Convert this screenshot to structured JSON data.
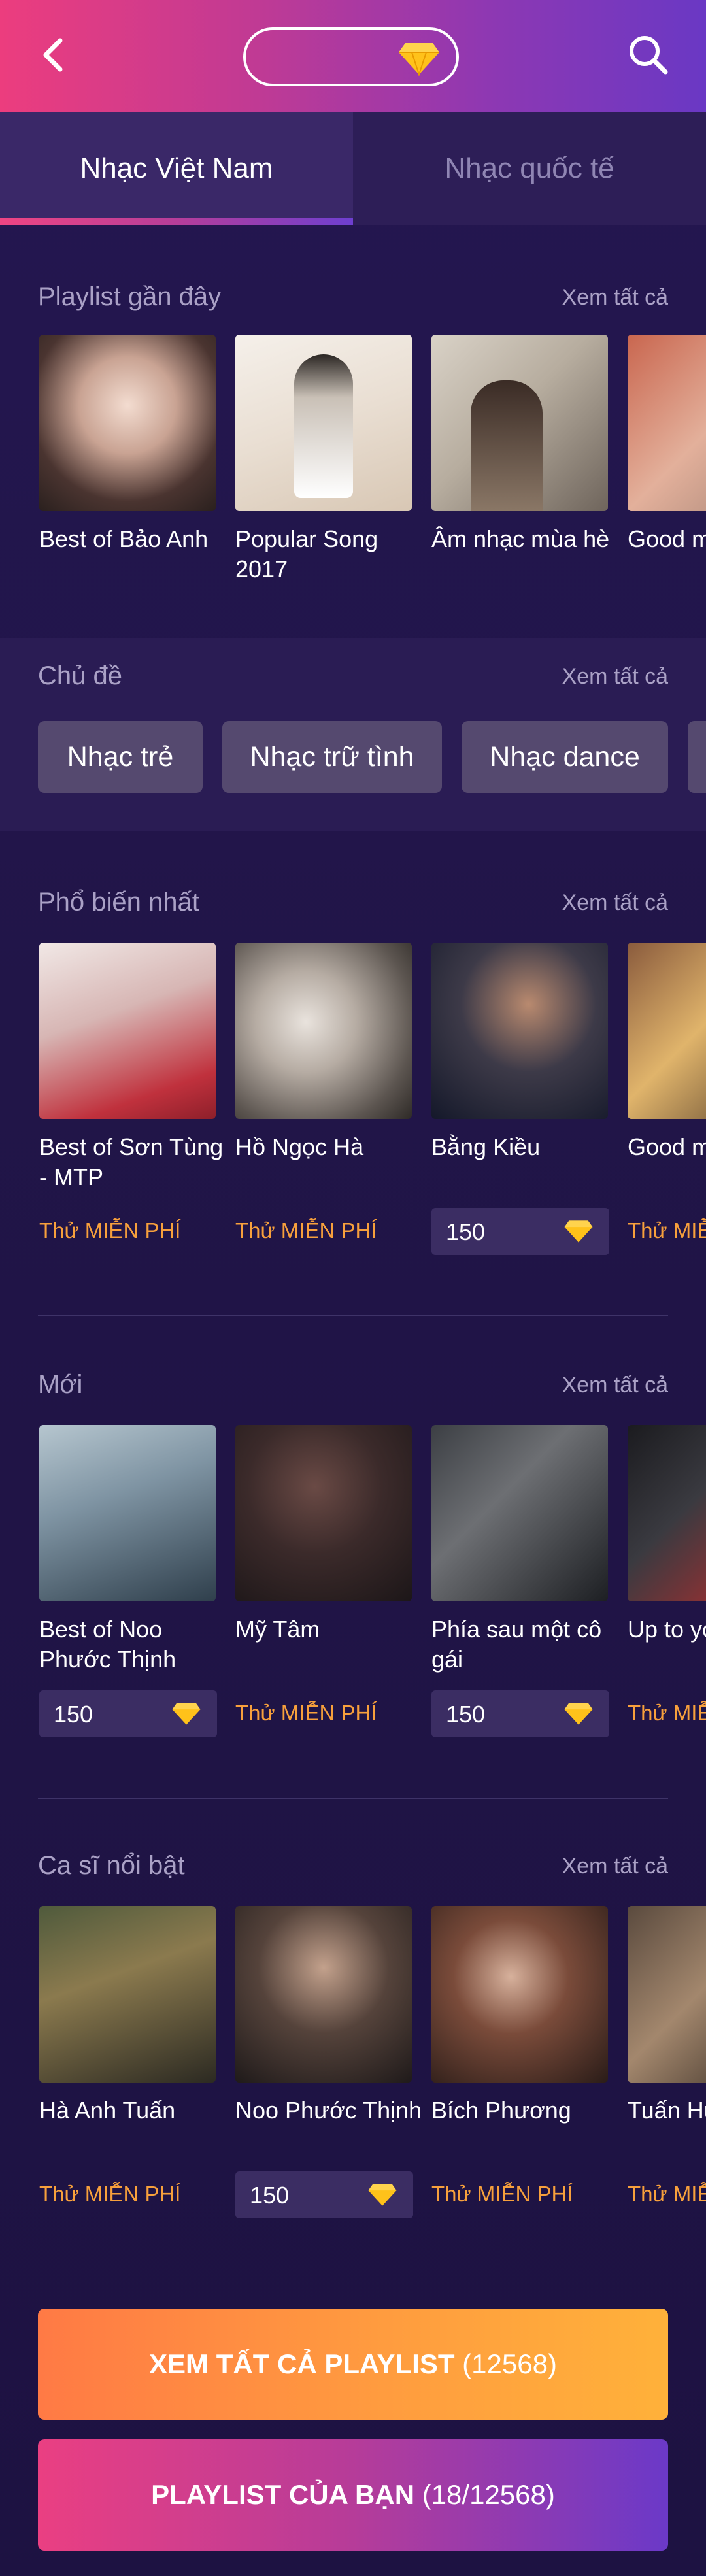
{
  "tabs": [
    {
      "label": "Nhạc Việt Nam",
      "active": true
    },
    {
      "label": "Nhạc quốc tế",
      "active": false
    }
  ],
  "see_all": "Xem tất cả",
  "sections": {
    "recent": {
      "title": "Playlist gần đây",
      "items": [
        {
          "caption": "Best of Bảo Anh"
        },
        {
          "caption": "Popular Song 2017"
        },
        {
          "caption": "Âm nhạc mùa hè"
        },
        {
          "caption": "Good m"
        }
      ]
    },
    "topics": {
      "title": "Chủ đề",
      "chips": [
        "Nhạc trẻ",
        "Nhạc trữ tình",
        "Nhạc dance"
      ]
    },
    "popular": {
      "title": "Phổ biến nhất",
      "items": [
        {
          "caption": "Best of Sơn Tùng - MTP",
          "price": "Thử MIỄN PHÍ"
        },
        {
          "caption": "Hồ Ngọc Hà",
          "price": "Thử MIỄN PHÍ"
        },
        {
          "caption": "Bằng Kiều",
          "price": "150"
        },
        {
          "caption": "Good m",
          "price": "Thử MIỄ"
        }
      ]
    },
    "new": {
      "title": "Mới",
      "items": [
        {
          "caption": "Best of Noo Phước Thịnh",
          "price": "150"
        },
        {
          "caption": "Mỹ Tâm",
          "price": "Thử MIỄN PHÍ"
        },
        {
          "caption": "Phía sau một cô gái",
          "price": "150"
        },
        {
          "caption": "Up to yo",
          "price": "Thử MIỄ"
        }
      ]
    },
    "artists": {
      "title": "Ca sĩ nổi bật",
      "items": [
        {
          "caption": "Hà Anh Tuấn",
          "price": "Thử MIỄN PHÍ"
        },
        {
          "caption": "Noo Phước Thịnh",
          "price": "150"
        },
        {
          "caption": "Bích Phương",
          "price": "Thử MIỄN PHÍ"
        },
        {
          "caption": "Tuấn Hư",
          "price": "Thử MIỄ"
        }
      ]
    }
  },
  "cta": {
    "all_playlists_bold": "XEM TẤT CẢ PLAYLIST",
    "all_playlists_count": " (12568)",
    "my_playlists_bold": "PLAYLIST CỦA BẠN",
    "my_playlists_count": " (18/12568)"
  },
  "colors": {
    "header_start": "#ec3d7e",
    "header_end": "#6a38c4",
    "free_text": "#f7a03c",
    "diamond": "#ffc21a",
    "cta_orange": "#ff9c3f"
  },
  "icons": [
    "back-icon",
    "diamond-icon",
    "search-icon"
  ]
}
